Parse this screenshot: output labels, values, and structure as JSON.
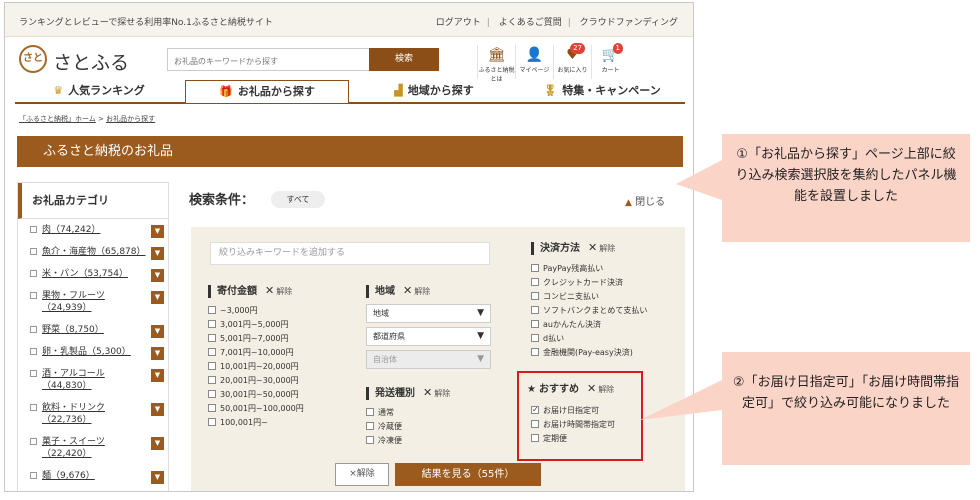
{
  "header": {
    "tagline": "ランキングとレビューで探せる利用率No.1ふるさと納税サイト",
    "links": [
      "ログアウト",
      "よくあるご質問",
      "クラウドファンディング"
    ],
    "logo_mark": "さと",
    "logo_text": "さとふる",
    "search_placeholder": "お礼品のキーワードから探す",
    "search_button": "検索",
    "icons": [
      {
        "label": "ふるさと納税とは",
        "icon": "building-icon",
        "badge": ""
      },
      {
        "label": "マイページ",
        "icon": "person-icon",
        "badge": ""
      },
      {
        "label": "お気に入り",
        "icon": "heart-icon",
        "badge": "27"
      },
      {
        "label": "カート",
        "icon": "cart-icon",
        "badge": "1"
      }
    ]
  },
  "nav": {
    "items": [
      "人気ランキング",
      "お礼品から探す",
      "地域から探す",
      "特集・キャンペーン"
    ]
  },
  "breadcrumb": {
    "home": "「ふるさと納税」ホーム",
    "sep": ">",
    "current": "お礼品から探す"
  },
  "banner": {
    "title": "ふるさと納税のお礼品"
  },
  "sidebar": {
    "title": "お礼品カテゴリ",
    "categories": [
      "肉（74,242）",
      "魚介・海産物（65,878）",
      "米・パン（53,754）",
      "果物・フルーツ（24,939）",
      "野菜（8,750）",
      "卵・乳製品（5,300）",
      "酒・アルコール（44,830）",
      "飲料・ドリンク（22,736）",
      "菓子・スイーツ（22,420）",
      "麺（9,676）"
    ]
  },
  "search": {
    "title": "検索条件：",
    "pill": "すべて",
    "close": "閉じる",
    "keyword_placeholder": "絞り込みキーワードを追加する",
    "remove": "解除",
    "donation": {
      "title": "寄付金額",
      "options": [
        "~3,000円",
        "3,001円~5,000円",
        "5,001円~7,000円",
        "7,001円~10,000円",
        "10,001円~20,000円",
        "20,001円~30,000円",
        "30,001円~50,000円",
        "50,001円~100,000円",
        "100,001円~"
      ]
    },
    "region": {
      "title": "地域",
      "selects": [
        "地域",
        "都道府県",
        "自治体"
      ]
    },
    "shipping": {
      "title": "発送種別",
      "options": [
        "通常",
        "冷蔵便",
        "冷凍便"
      ]
    },
    "payment": {
      "title": "決済方法",
      "options": [
        "PayPay残高払い",
        "クレジットカード決済",
        "コンビニ支払い",
        "ソフトバンクまとめて支払い",
        "auかんたん決済",
        "d払い",
        "金融機関(Pay-easy決済)"
      ]
    },
    "recommended": {
      "title": "おすすめ",
      "options": [
        "お届け日指定可",
        "お届け時間帯指定可",
        "定期便"
      ],
      "checked": [
        true,
        false,
        false
      ]
    },
    "clear_button": "×解除",
    "result_button": "結果を見る（55件）"
  },
  "callouts": [
    "①「お礼品から探す」ページ上部に絞り込み検索選択肢を集約したパネル機能を設置しました",
    "②「お届け日指定可」「お届け時間帯指定可」で絞り込み可能になりました"
  ]
}
